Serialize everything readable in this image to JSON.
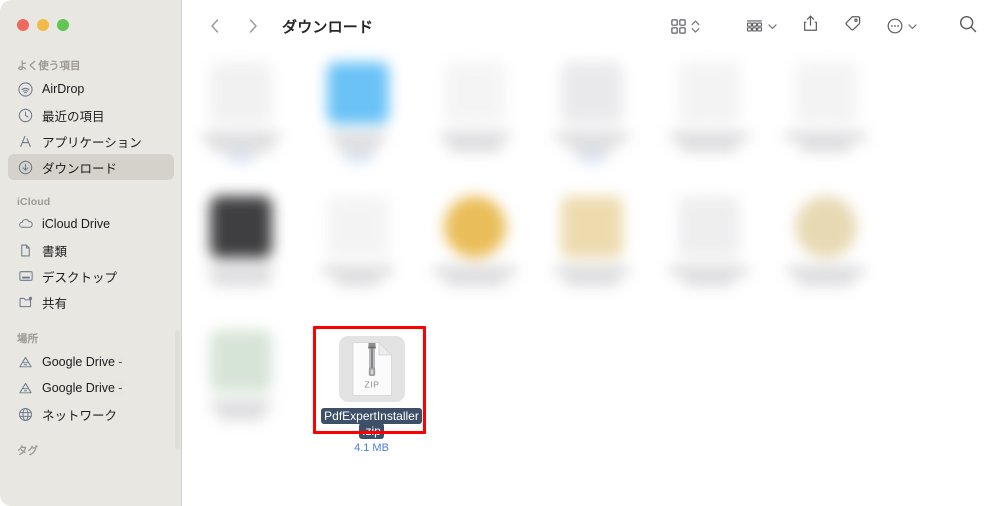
{
  "window": {
    "title": "ダウンロード",
    "traffic_lights": [
      {
        "name": "close",
        "color": "#ec6a5e"
      },
      {
        "name": "minimize",
        "color": "#f2bb47"
      },
      {
        "name": "maximize",
        "color": "#61c554"
      }
    ]
  },
  "sidebar": {
    "sections": [
      {
        "title": "よく使う項目",
        "items": [
          {
            "label": "AirDrop",
            "icon": "airdrop-icon",
            "selected": false,
            "redacted": false
          },
          {
            "label": "最近の項目",
            "icon": "clock-icon",
            "selected": false,
            "redacted": false
          },
          {
            "label": "アプリケーション",
            "icon": "applications-icon",
            "selected": false,
            "redacted": false
          },
          {
            "label": "ダウンロード",
            "icon": "downloads-icon",
            "selected": true,
            "redacted": false
          }
        ]
      },
      {
        "title": "iCloud",
        "items": [
          {
            "label": "iCloud Drive",
            "icon": "cloud-icon",
            "selected": false,
            "redacted": false
          },
          {
            "label": "書類",
            "icon": "document-icon",
            "selected": false,
            "redacted": false
          },
          {
            "label": "デスクトップ",
            "icon": "desktop-icon",
            "selected": false,
            "redacted": false
          },
          {
            "label": "共有",
            "icon": "shared-folder-icon",
            "selected": false,
            "redacted": false
          }
        ]
      },
      {
        "title": "場所",
        "items": [
          {
            "label": "Google Drive -",
            "icon": "google-drive-icon",
            "selected": false,
            "redacted": true
          },
          {
            "label": "Google Drive -",
            "icon": "google-drive-icon",
            "selected": false,
            "redacted": true
          },
          {
            "label": "ネットワーク",
            "icon": "network-icon",
            "selected": false,
            "redacted": false
          }
        ]
      },
      {
        "title": "タグ",
        "items": []
      }
    ]
  },
  "toolbar": {
    "back_label": "戻る",
    "forward_label": "進む",
    "buttons": [
      {
        "name": "view-mode-button",
        "icon": "grid-view-icon",
        "has_chevron": true,
        "chevron": "updown"
      },
      {
        "name": "group-by-button",
        "icon": "group-by-icon",
        "has_chevron": true,
        "chevron": "down"
      },
      {
        "name": "share-button",
        "icon": "share-icon",
        "has_chevron": false,
        "chevron": ""
      },
      {
        "name": "tag-button",
        "icon": "tag-icon",
        "has_chevron": false,
        "chevron": ""
      },
      {
        "name": "more-actions-button",
        "icon": "ellipsis-circle-icon",
        "has_chevron": true,
        "chevron": "down"
      },
      {
        "name": "search-button",
        "icon": "search-icon",
        "has_chevron": false,
        "chevron": ""
      }
    ]
  },
  "file_grid": {
    "selected_file": {
      "name_line1": "PdfExpertInstaller",
      "name_line2": ".zip",
      "size": "4.1 MB",
      "icon_label": "ZIP",
      "selection_color": "#3d5068",
      "size_color": "#4a7fd4"
    },
    "annotation": {
      "name": "red-highlight-box",
      "color": "#ff0000"
    },
    "rows": [
      {
        "cells": [
          {
            "redacted": true,
            "icon_color": "#f0f0f1",
            "line_widths": [
              78,
              62
            ],
            "has_size": true
          },
          {
            "redacted": true,
            "icon_color": "#5ebdf5",
            "line_widths": [
              56,
              40
            ],
            "has_size": true
          },
          {
            "redacted": true,
            "icon_color": "#f4f4f5",
            "line_widths": [
              70,
              52
            ],
            "has_size": false
          },
          {
            "redacted": true,
            "icon_color": "#e8e8ea",
            "line_widths": [
              74,
              48
            ],
            "has_size": true
          },
          {
            "redacted": true,
            "icon_color": "#f2f2f3",
            "line_widths": [
              80,
              56
            ],
            "has_size": false
          },
          {
            "redacted": true,
            "icon_color": "#f2f2f3",
            "line_widths": [
              82,
              50
            ],
            "has_size": false
          }
        ]
      },
      {
        "cells": [
          {
            "redacted": true,
            "icon_color": "#2f2f31",
            "line_widths": [
              66,
              58
            ],
            "has_size": false
          },
          {
            "redacted": true,
            "icon_color": "#f3f3f4",
            "line_widths": [
              72,
              44
            ],
            "has_size": false
          },
          {
            "redacted": true,
            "icon_color": "#e8b84b",
            "line_widths": [
              84,
              60
            ],
            "has_size": false
          },
          {
            "redacted": true,
            "icon_color": "#ecd8a8",
            "line_widths": [
              76,
              54
            ],
            "has_size": false
          },
          {
            "redacted": true,
            "icon_color": "#ededee",
            "line_widths": [
              80,
              52
            ],
            "has_size": false
          },
          {
            "redacted": true,
            "icon_color": "#e6d6ae",
            "line_widths": [
              78,
              56
            ],
            "has_size": false
          }
        ]
      },
      {
        "cells": [
          {
            "redacted": true,
            "icon_color": "#d3e2d3",
            "line_widths": [
              62,
              46
            ],
            "has_size": false
          }
        ]
      }
    ]
  }
}
